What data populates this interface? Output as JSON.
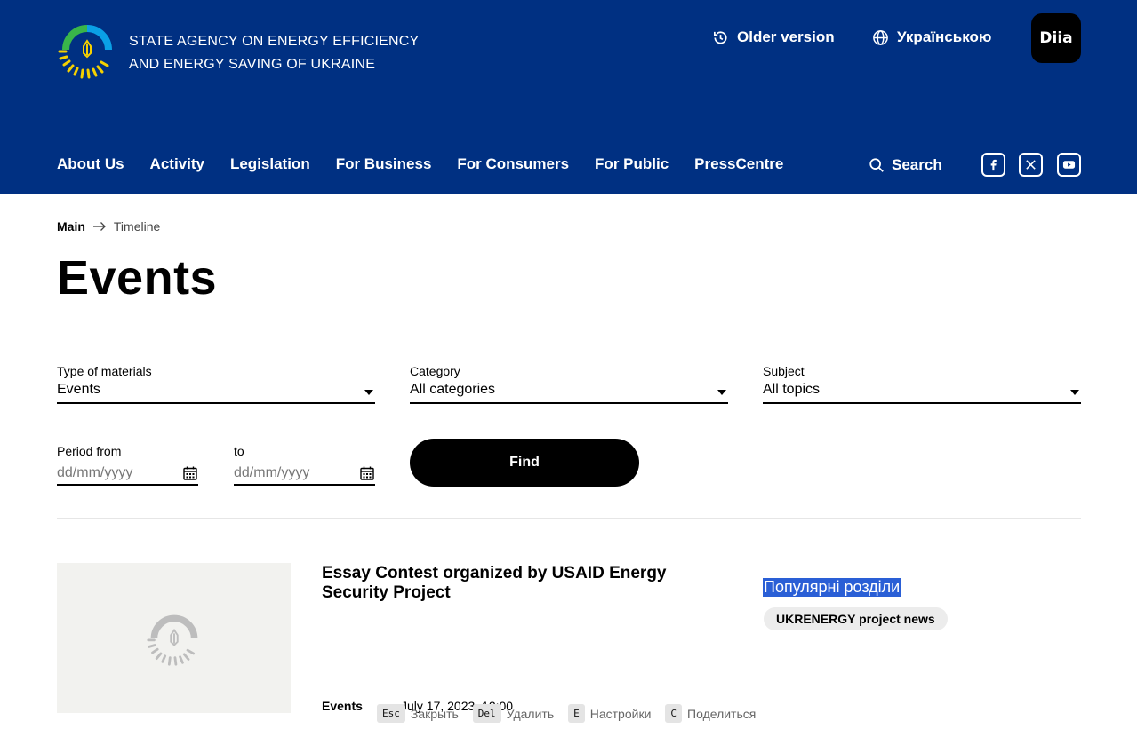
{
  "header": {
    "agency_line1": "STATE AGENCY ON ENERGY EFFICIENCY",
    "agency_line2": "AND ENERGY SAVING OF UKRAINE",
    "older_version": "Older version",
    "language": "Українською",
    "diia": "Diia",
    "nav": [
      "About Us",
      "Activity",
      "Legislation",
      "For Business",
      "For Consumers",
      "For Public",
      "PressCentre"
    ],
    "search": "Search",
    "social_icons": [
      "facebook-icon",
      "x-icon",
      "youtube-icon"
    ],
    "colors": {
      "header_bg": "#003082",
      "logo_yellow": "#f5d000",
      "logo_green": "#39b54a",
      "logo_blue": "#0aa0e6"
    }
  },
  "breadcrumb": {
    "main": "Main",
    "current": "Timeline"
  },
  "page_title": "Events",
  "filters": {
    "type": {
      "label": "Type of materials",
      "value": "Events"
    },
    "category": {
      "label": "Category",
      "value": "All categories"
    },
    "subject": {
      "label": "Subject",
      "value": "All topics"
    },
    "period_from": {
      "label": "Period from",
      "placeholder": "dd/mm/yyyy"
    },
    "period_to": {
      "label": "to",
      "placeholder": "dd/mm/yyyy"
    },
    "find": "Find"
  },
  "card": {
    "title": "Essay Contest organized by USAID Energy Security Project",
    "type": "Events",
    "date": "July 17, 2023, 12:00",
    "popular_heading": "Популярні розділи",
    "tag": "UKRENERGY project news"
  },
  "hints": [
    {
      "key": "Esc",
      "label": "Закрыть"
    },
    {
      "key": "Del",
      "label": "Удалить"
    },
    {
      "key": "E",
      "label": "Настройки"
    },
    {
      "key": "C",
      "label": "Поделиться"
    }
  ]
}
